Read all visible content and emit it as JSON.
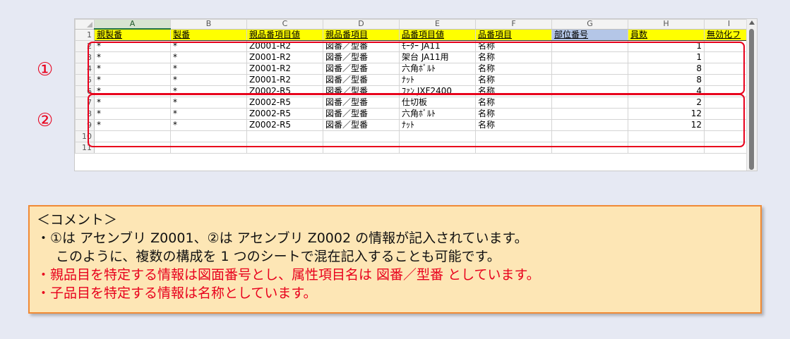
{
  "sheet": {
    "columns": [
      "A",
      "B",
      "C",
      "D",
      "E",
      "F",
      "G",
      "H",
      "I"
    ],
    "headers": [
      "親製番",
      "製番",
      "親品番項目値",
      "親品番項目",
      "品番項目値",
      "品番項目",
      "部位番号",
      "員数",
      "無効化フ"
    ],
    "rows": [
      [
        "*",
        "*",
        "Z0001-R2",
        "図番／型番",
        "ﾓｰﾀｰ JA11",
        "名称",
        "",
        "1",
        ""
      ],
      [
        "*",
        "*",
        "Z0001-R2",
        "図番／型番",
        "架台 JA11用",
        "名称",
        "",
        "1",
        ""
      ],
      [
        "*",
        "*",
        "Z0001-R2",
        "図番／型番",
        "六角ﾎﾞﾙﾄ",
        "名称",
        "",
        "8",
        ""
      ],
      [
        "*",
        "*",
        "Z0001-R2",
        "図番／型番",
        "ﾅｯﾄ",
        "名称",
        "",
        "8",
        ""
      ],
      [
        "*",
        "*",
        "Z0002-R5",
        "図番／型番",
        "ﾌｧﾝ JXF2400",
        "名称",
        "",
        "4",
        ""
      ],
      [
        "*",
        "*",
        "Z0002-R5",
        "図番／型番",
        "仕切板",
        "名称",
        "",
        "2",
        ""
      ],
      [
        "*",
        "*",
        "Z0002-R5",
        "図番／型番",
        "六角ﾎﾞﾙﾄ",
        "名称",
        "",
        "12",
        ""
      ],
      [
        "*",
        "*",
        "Z0002-R5",
        "図番／型番",
        "ﾅｯﾄ",
        "名称",
        "",
        "12",
        ""
      ],
      [
        "",
        "",
        "",
        "",
        "",
        "",
        "",
        "",
        ""
      ],
      [
        "",
        "",
        "",
        "",
        "",
        "",
        "",
        "",
        ""
      ]
    ],
    "row_numbers": [
      "1",
      "2",
      "3",
      "4",
      "5",
      "6",
      "7",
      "8",
      "9",
      "10",
      "11"
    ]
  },
  "markers": [
    "①",
    "②"
  ],
  "comment": {
    "title": "＜コメント＞",
    "line1": "・①は アセンブリ Z0001、②は アセンブリ Z0002 の情報が記入されています。",
    "line2": "このように、複数の構成を 1 つのシートで混在記入することも可能です。",
    "line3": "・親品目を特定する情報は図面番号とし、属性項目名は 図番／型番 としています。",
    "line4": "・子品目を特定する情報は名称としています。"
  },
  "colors": {
    "header_yellow": "#ffff00",
    "header_blue": "#b4c6e7",
    "group_red": "#e8001c",
    "comment_bg": "#fde6b5",
    "comment_border": "#f08a35"
  }
}
